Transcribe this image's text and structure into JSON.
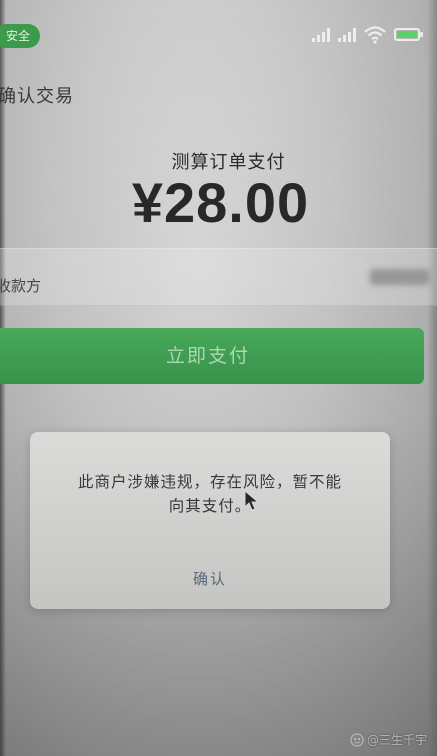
{
  "status_bar": {
    "secure_label": "安全",
    "signal_icon": "signal-icon",
    "wifi_icon": "wifi-icon",
    "battery_icon": "battery-icon",
    "battery_color": "#5fd36f"
  },
  "nav": {
    "title": "确认交易"
  },
  "payment": {
    "order_title": "测算订单支付",
    "amount": "¥28.00"
  },
  "payee": {
    "label": "收款方"
  },
  "pay_button": {
    "label": "立即支付",
    "color": "#3e9e4f"
  },
  "dialog": {
    "message_line1": "此商户涉嫌违规，存在风险，暂不能",
    "message_line2": "向其支付。",
    "confirm_label": "确认",
    "confirm_color": "#6d7d96"
  },
  "watermark": {
    "text": "@三生千宇"
  }
}
